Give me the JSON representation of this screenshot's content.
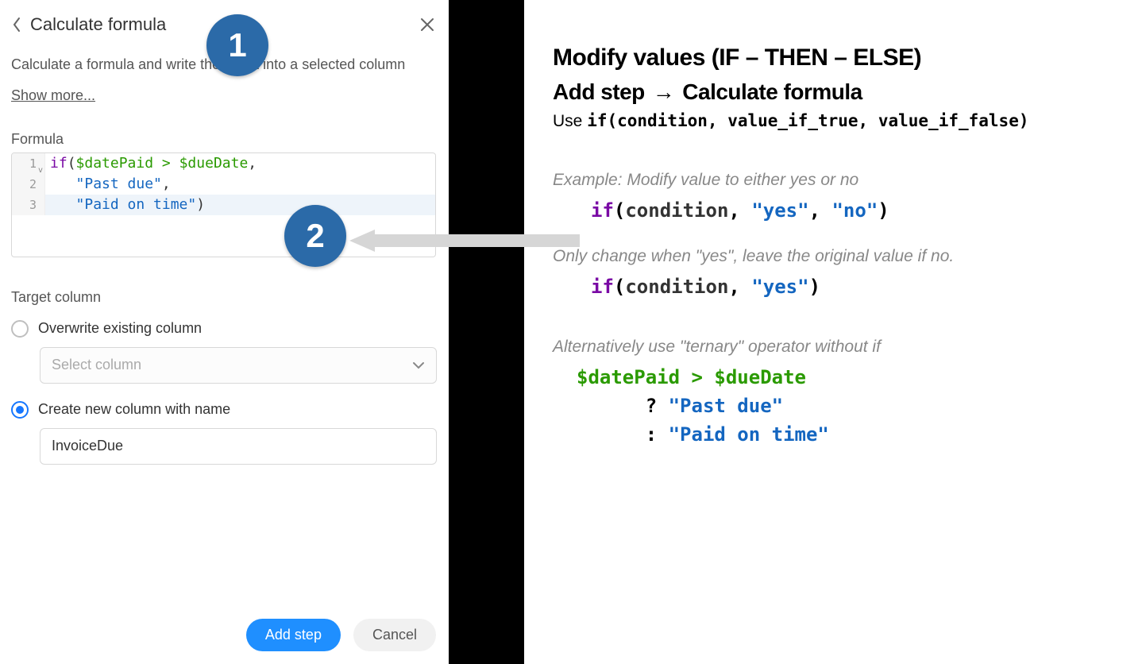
{
  "panel": {
    "title": "Calculate formula",
    "description": "Calculate a formula and write the result into a selected column",
    "show_more": "Show more...",
    "formula_label": "Formula",
    "target_label": "Target column",
    "radio_overwrite": "Overwrite existing column",
    "radio_create": "Create new column with name",
    "select_placeholder": "Select column",
    "new_column_value": "InvoiceDue",
    "btn_primary": "Add step",
    "btn_secondary": "Cancel"
  },
  "formula": {
    "line1_gutter": "1",
    "line2_gutter": "2",
    "line3_gutter": "3",
    "l1_fn": "if",
    "l1_open": "(",
    "l1_var1": "$datePaid",
    "l1_op": " > ",
    "l1_var2": "$dueDate",
    "l1_comma": ",",
    "l2_indent": "   ",
    "l2_str": "\"Past due\"",
    "l2_comma": ",",
    "l3_indent": "   ",
    "l3_str": "\"Paid on time\"",
    "l3_close": ")"
  },
  "callouts": {
    "one": "1",
    "two": "2"
  },
  "doc": {
    "heading1": "Modify values (IF – THEN – ELSE)",
    "heading2a": "Add step",
    "heading2_arrow": "→",
    "heading2b": "Calculate formula",
    "use_prefix": "Use ",
    "use_code": "if(condition, value_if_true, value_if_false)",
    "cap1": "Example: Modify value to either yes or no",
    "ex1_fn": "if",
    "ex1_open": "(",
    "ex1_cond": "condition",
    "ex1_c1": ", ",
    "ex1_s1": "\"yes\"",
    "ex1_c2": ", ",
    "ex1_s2": "\"no\"",
    "ex1_close": ")",
    "cap2": "Only change when \"yes\", leave the original value if no.",
    "ex2_fn": "if",
    "ex2_open": "(",
    "ex2_cond": "condition",
    "ex2_c1": ", ",
    "ex2_s1": "\"yes\"",
    "ex2_close": ")",
    "cap3": "Alternatively use \"ternary\" operator without if",
    "tern_var1": "$datePaid",
    "tern_op": " > ",
    "tern_var2": "$dueDate",
    "tern_q": "      ? ",
    "tern_s1": "\"Past due\"",
    "tern_colon": "      : ",
    "tern_s2": "\"Paid on time\""
  }
}
